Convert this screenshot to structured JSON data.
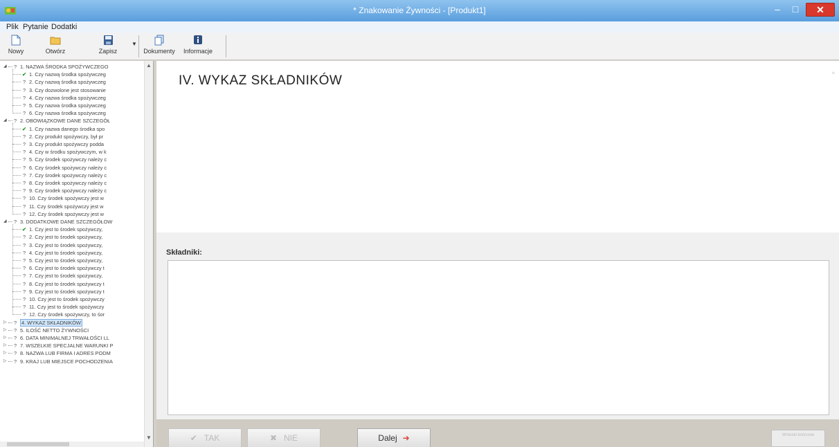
{
  "window": {
    "title": "* Znakowanie Żywności - [Produkt1]",
    "minimize_glyph": "–",
    "maximize_glyph": "□",
    "close_glyph": "✕"
  },
  "menu": {
    "items": [
      "Plik",
      "Pytanie",
      "Dodatki"
    ]
  },
  "toolbar": {
    "new_label": "Nowy",
    "open_label": "Otwórz",
    "save_label": "Zapisz",
    "documents_label": "Dokumenty",
    "info_label": "Informacje"
  },
  "tree": {
    "sections": [
      {
        "id": "s1",
        "label": "1. NAZWA ŚRODKA SPOŻYWCZEGO",
        "mark": "?",
        "items": [
          {
            "label": "1. Czy nazwą środka spożywczeg",
            "mark": "✔"
          },
          {
            "label": "2. Czy nazwą środka spożywczeg",
            "mark": "?"
          },
          {
            "label": "3. Czy dozwolone jest stosowanie",
            "mark": "?"
          },
          {
            "label": "4. Czy nazwa środka spożywczeg",
            "mark": "?"
          },
          {
            "label": "5. Czy nazwa środka spożywczeg",
            "mark": "?"
          },
          {
            "label": "6. Czy nazwa środka spożywczeg",
            "mark": "?"
          }
        ]
      },
      {
        "id": "s2",
        "label": "2. OBOWIĄZKOWE DANE SZCZEGÓŁ",
        "mark": "?",
        "items": [
          {
            "label": "1. Czy nazwa danego środka spo",
            "mark": "✔"
          },
          {
            "label": "2. Czy produkt spożywczy, był pr",
            "mark": "?"
          },
          {
            "label": "3. Czy produkt spożywczy podda",
            "mark": "?"
          },
          {
            "label": "4. Czy w środku spożywczym, w k",
            "mark": "?"
          },
          {
            "label": "5. Czy środek spożywczy należy c",
            "mark": "?"
          },
          {
            "label": "6. Czy środek spożywczy należy c",
            "mark": "?"
          },
          {
            "label": "7. Czy środek spożywczy należy c",
            "mark": "?"
          },
          {
            "label": "8. Czy środek spożywczy należy c",
            "mark": "?"
          },
          {
            "label": "9. Czy środek spożywczy należy c",
            "mark": "?"
          },
          {
            "label": "10. Czy środek spożywczy jest w",
            "mark": "?"
          },
          {
            "label": "11. Czy środek spożywczy jest w",
            "mark": "?"
          },
          {
            "label": "12. Czy środek spożywczy jest w",
            "mark": "?"
          }
        ]
      },
      {
        "id": "s3",
        "label": "3. DODATKOWE DANE SZCZEGÓŁOW",
        "mark": "?",
        "items": [
          {
            "label": "1. Czy jest to środek spożywczy,",
            "mark": "✔"
          },
          {
            "label": "2. Czy jest to środek spożywczy,",
            "mark": "?"
          },
          {
            "label": "3. Czy jest to środek spożywczy,",
            "mark": "?"
          },
          {
            "label": "4. Czy jest to środek spożywczy,",
            "mark": "?"
          },
          {
            "label": "5. Czy jest to środek spożywczy,",
            "mark": "?"
          },
          {
            "label": "6. Czy jest to środek spożywczy t",
            "mark": "?"
          },
          {
            "label": "7. Czy jest to środek spożywczy,",
            "mark": "?"
          },
          {
            "label": "8. Czy jest to środek spożywczy t",
            "mark": "?"
          },
          {
            "label": "9. Czy jest to środek spożywczy t",
            "mark": "?"
          },
          {
            "label": "10. Czy jest to środek spożywczy",
            "mark": "?"
          },
          {
            "label": "11. Czy jest to środek spożywczy",
            "mark": "?"
          },
          {
            "label": "12. Czy środek spożywczy, to śor",
            "mark": "?"
          }
        ]
      }
    ],
    "collapsed": [
      {
        "label": "4. WYKAZ SKŁADNIKÓW",
        "mark": "?",
        "selected": true
      },
      {
        "label": "5. ILOŚĆ NETTO ŻYWNOŚCI",
        "mark": "?"
      },
      {
        "label": "6. DATA MINIMALNEJ TRWAŁOŚCI LL",
        "mark": "?"
      },
      {
        "label": "7. WSZELKIE SPECJALNE WARUNKI P",
        "mark": "?"
      },
      {
        "label": "8. NAZWA LUB FIRMA I ADRES PODM",
        "mark": "?"
      },
      {
        "label": "9. KRAJ LUB MIEJSCE POCHODZENIA",
        "mark": "?"
      }
    ]
  },
  "content": {
    "section_title": "IV. WYKAZ SKŁADNIKÓW",
    "ingredients_label": "Składniki:",
    "ingredients_value": ""
  },
  "bottom": {
    "yes_label": "TAK",
    "no_label": "NIE",
    "next_label": "Dalej",
    "finish_label": "Wnioski końcowe"
  },
  "colors": {
    "titlebar": "#6aa9e4",
    "close_button": "#d9382c",
    "selected_bg": "#cfe6fb",
    "ok_mark": "#2c9a2c",
    "next_arrow": "#d9463a"
  }
}
